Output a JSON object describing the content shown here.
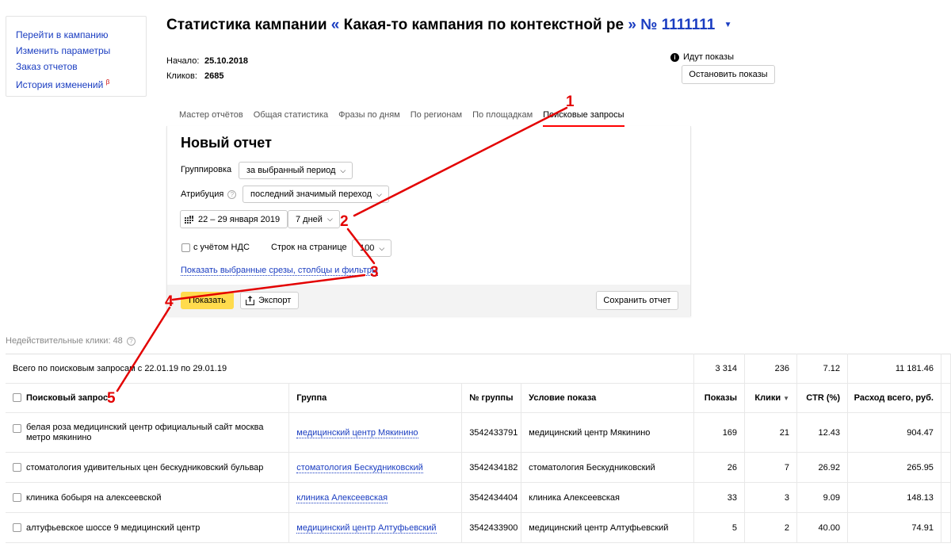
{
  "left_nav": {
    "items": [
      "Перейти в кампанию",
      "Изменить параметры",
      "Заказ отчетов",
      "История изменений"
    ],
    "beta_mark": "β"
  },
  "header": {
    "title_prefix": "Статистика кампании",
    "quote_open": "«",
    "campaign_name": "Какая-то кампания по контекстной ре",
    "quote_close": "»",
    "campaign_number": "№ 1111111",
    "start_label": "Начало:",
    "start_value": "25.10.2018",
    "clicks_label": "Кликов:",
    "clicks_value": "2685",
    "status_text": "Идут показы",
    "stop_button": "Остановить показы"
  },
  "tabs": {
    "items": [
      "Мастер отчётов",
      "Общая статистика",
      "Фразы по дням",
      "По регионам",
      "По площадкам",
      "Поисковые запросы"
    ],
    "active_index": 5
  },
  "report": {
    "title": "Новый отчет",
    "grouping_label": "Группировка",
    "grouping_value": "за выбранный период",
    "attribution_label": "Атрибуция",
    "attribution_value": "последний значимый переход",
    "date_range": "22 – 29 января 2019",
    "period_value": "7 дней",
    "vat_label": "с учётом НДС",
    "rows_label": "Строк на странице",
    "rows_value": "100",
    "show_link": "Показать выбранные срезы, столбцы и фильтры",
    "show_button": "Показать",
    "export_button": "Экспорт",
    "save_button": "Сохранить отчет"
  },
  "invalid_clicks": "Недействительные клики: 48",
  "table": {
    "total_label": "Всего по поисковым запросам с 22.01.19 по 29.01.19",
    "totals": {
      "impressions": "3 314",
      "clicks": "236",
      "ctr": "7.12",
      "spend": "11 181.46"
    },
    "headers": {
      "query": "Поисковый запрос",
      "group": "Группа",
      "group_no": "№ группы",
      "condition": "Условие показа",
      "impressions": "Показы",
      "clicks": "Клики",
      "ctr": "CTR (%)",
      "spend": "Расход всего, руб."
    },
    "rows": [
      {
        "query": "белая роза медицинский центр официальный сайт москва метро мякинино",
        "group": "медицинский центр Мякинино",
        "group_no": "3542433791",
        "condition": "медицинский центр Мякинино",
        "impressions": "169",
        "clicks": "21",
        "ctr": "12.43",
        "spend": "904.47"
      },
      {
        "query": "стоматология удивительных цен бескудниковский бульвар",
        "group": "стоматология Бескудниковский",
        "group_no": "3542434182",
        "condition": "стоматология Бескудниковский",
        "impressions": "26",
        "clicks": "7",
        "ctr": "26.92",
        "spend": "265.95"
      },
      {
        "query": "клиника бобыря на алексеевской",
        "group": "клиника Алексеевская",
        "group_no": "3542434404",
        "condition": "клиника Алексеевская",
        "impressions": "33",
        "clicks": "3",
        "ctr": "9.09",
        "spend": "148.13"
      },
      {
        "query": "алтуфьевское шоссе 9 медицинский центр",
        "group": "медицинский центр Алтуфьевский",
        "group_no": "3542433900",
        "condition": "медицинский центр Алтуфьевский",
        "impressions": "5",
        "clicks": "2",
        "ctr": "40.00",
        "spend": "74.91"
      }
    ]
  },
  "annotations": {
    "labels": [
      "1",
      "2",
      "3",
      "4",
      "5"
    ],
    "color": "#e30000"
  }
}
